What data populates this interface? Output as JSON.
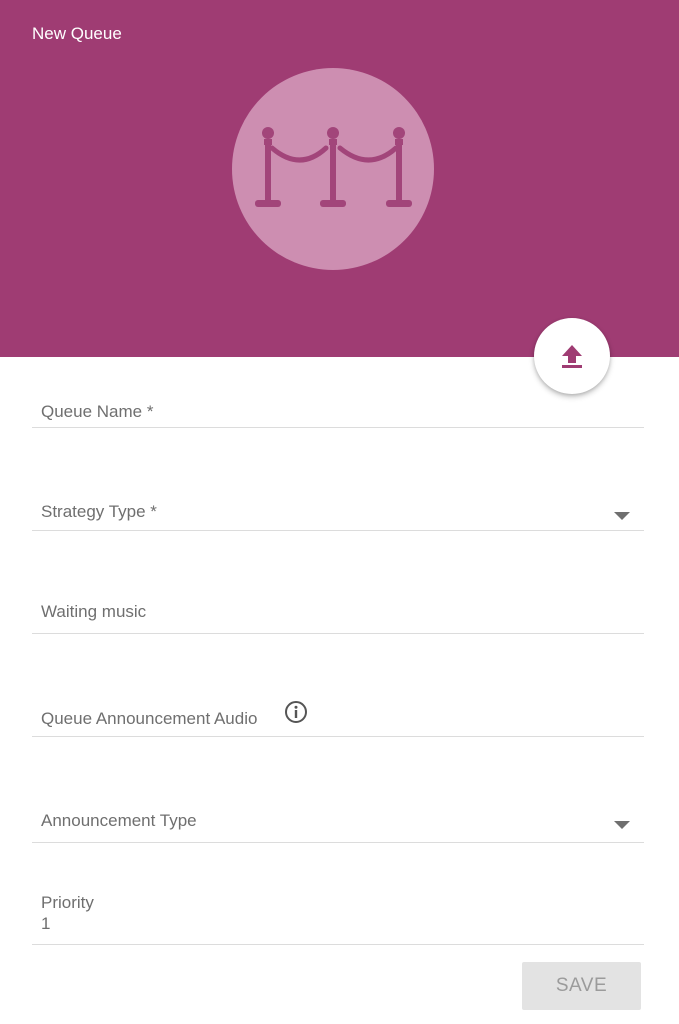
{
  "header": {
    "title": "New Queue",
    "background_color": "#9f3c73",
    "avatar_icon": "queue-stanchions-icon",
    "upload_icon": "upload-icon"
  },
  "form": {
    "queue_name": {
      "label": "Queue Name *",
      "value": ""
    },
    "strategy_type": {
      "label": "Strategy Type *",
      "value": "",
      "icon": "dropdown-arrow-icon"
    },
    "waiting_music": {
      "label": "Waiting music",
      "value": ""
    },
    "queue_announcement_audio": {
      "label": "Queue Announcement Audio",
      "value": "",
      "icon": "info-icon"
    },
    "announcement_type": {
      "label": "Announcement Type",
      "value": "",
      "icon": "dropdown-arrow-icon"
    },
    "priority": {
      "label": "Priority",
      "value": "1"
    }
  },
  "actions": {
    "save_label": "SAVE"
  }
}
